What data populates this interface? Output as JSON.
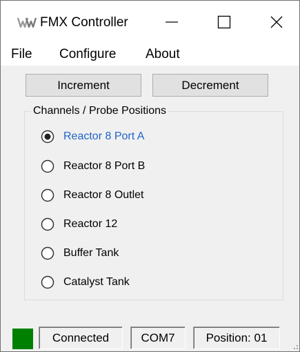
{
  "window": {
    "title": "FMX Controller",
    "controls": {
      "minimize_icon": "minimize-icon",
      "maximize_icon": "maximize-icon",
      "close_icon": "close-icon"
    }
  },
  "menu": {
    "items": [
      {
        "label": "File"
      },
      {
        "label": "Configure"
      },
      {
        "label": "About"
      }
    ]
  },
  "toolbar": {
    "increment_label": "Increment",
    "decrement_label": "Decrement"
  },
  "channels": {
    "group_label": "Channels / Probe Positions",
    "selected_index": 0,
    "options": [
      {
        "label": "Reactor 8 Port A",
        "checked": true
      },
      {
        "label": "Reactor 8 Port B",
        "checked": false
      },
      {
        "label": "Reactor 8 Outlet",
        "checked": false
      },
      {
        "label": "Reactor 12",
        "checked": false
      },
      {
        "label": "Buffer Tank",
        "checked": false
      },
      {
        "label": "Catalyst Tank",
        "checked": false
      }
    ]
  },
  "status": {
    "indicator_color": "#008000",
    "connection": "Connected",
    "port": "COM7",
    "position": "Position: 01"
  },
  "colors": {
    "selected_text": "#1e64c8",
    "window_bg": "#f0f0f0",
    "button_bg": "#e1e1e1"
  }
}
